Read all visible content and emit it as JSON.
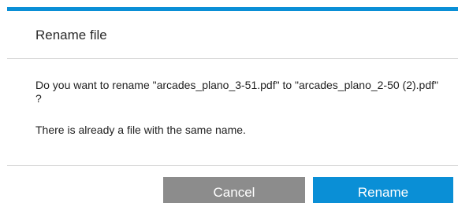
{
  "dialog": {
    "title": "Rename file",
    "message": "Do you want to rename \"arcades_plano_3-51.pdf\" to \"arcades_plano_2-50 (2).pdf\" ?",
    "note": "There is already a file with the same name.",
    "cancel_label": "Cancel",
    "rename_label": "Rename"
  },
  "colors": {
    "accent": "#0a8fd6",
    "cancel_button": "#8c8c8c",
    "divider": "#d5d5d5"
  }
}
